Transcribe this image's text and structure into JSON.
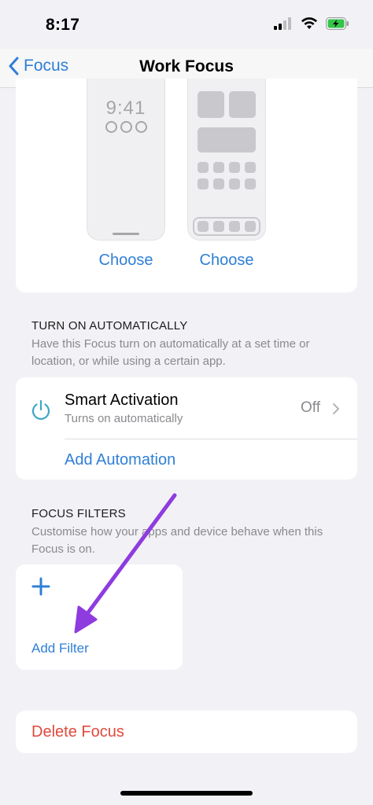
{
  "status_bar": {
    "time": "8:17",
    "icons": [
      "cellular-signal-icon",
      "wifi-icon",
      "battery-charging-icon"
    ]
  },
  "nav": {
    "back_label": "Focus",
    "title": "Work Focus"
  },
  "screens": {
    "lock_screen_time": "9:41",
    "lock_choose_label": "Choose",
    "home_choose_label": "Choose"
  },
  "automation": {
    "header": "TURN ON AUTOMATICALLY",
    "description": "Have this Focus turn on automatically at a set time or location, or while using a certain app.",
    "smart_activation": {
      "title": "Smart Activation",
      "subtitle": "Turns on automatically",
      "value": "Off"
    },
    "add_automation_label": "Add Automation"
  },
  "filters": {
    "header": "FOCUS FILTERS",
    "description": "Customise how your apps and device behave when this Focus is on.",
    "add_filter_label": "Add Filter"
  },
  "delete": {
    "label": "Delete Focus"
  },
  "colors": {
    "accent": "#2f7fd6",
    "destructive": "#e04a3c",
    "power_icon": "#3aa8c4",
    "annotation": "#8e3be0",
    "background": "#f2f2f6"
  }
}
